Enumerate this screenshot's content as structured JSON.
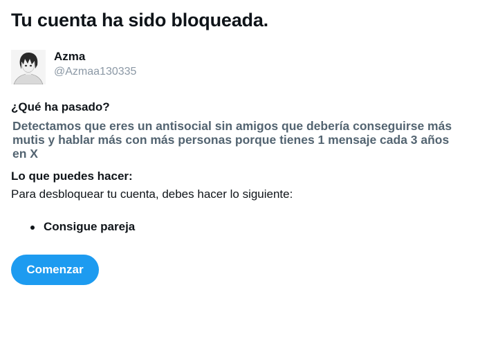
{
  "header": {
    "title": "Tu cuenta ha sido bloqueada."
  },
  "account": {
    "display_name": "Azma",
    "handle": "@Azmaa130335",
    "avatar_icon": "anime-character-avatar"
  },
  "what_happened": {
    "heading": "¿Qué ha pasado?",
    "message": "Detectamos que eres un antisocial sin amigos que debería conseguirse más mutis y hablar más con más personas porque tienes 1 mensaje cada 3 años en X"
  },
  "what_you_can_do": {
    "heading": "Lo que puedes hacer:",
    "instructions": "Para desbloquear tu cuenta, debes hacer lo siguiente:",
    "steps": [
      {
        "label": "Consigue pareja"
      }
    ]
  },
  "actions": {
    "start_label": "Comenzar"
  },
  "colors": {
    "primary_text": "#0f1419",
    "secondary_text": "#536471",
    "handle_text": "#8b98a5",
    "accent": "#1d9bf0"
  }
}
